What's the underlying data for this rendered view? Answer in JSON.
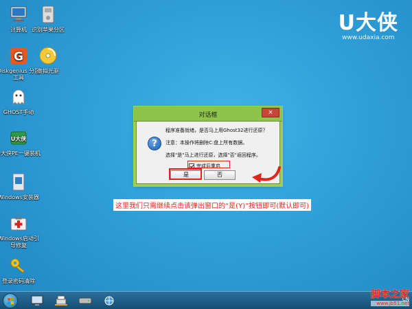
{
  "desktop": {
    "icons": [
      {
        "label": "计算机"
      },
      {
        "label": "识别苹果分区"
      },
      {
        "label": "Diskgenius 分区工具"
      },
      {
        "label": "虚拟光驱"
      },
      {
        "label": "GHOST手动"
      },
      {
        "label": "U大侠PE一键装机"
      },
      {
        "label": "Windows安装器"
      },
      {
        "label": "Windows启动引导修复"
      },
      {
        "label": "登录密码清除"
      }
    ]
  },
  "brand": {
    "logo": "U大侠",
    "url": "www.udaxia.com"
  },
  "dialog": {
    "title": "对话框",
    "close": "×",
    "line1": "程序准备就绪，是否马上用Ghost32进行还原？",
    "line2": "注意：本操作将删除C:盘上所有数据。",
    "line3": "选择\"是\"马上进行还原，选择\"否\"返回程序。",
    "checkbox_label": "完成后重启",
    "checkbox_checked": true,
    "yes_label": "是",
    "no_label": "否"
  },
  "annotation": "这里我们只需继续点击该弹出窗口的“是(Y)”按钮即可(默认即可)",
  "taskbar": {
    "tray_lang": "CN"
  },
  "watermark": {
    "line1": "脚本之家",
    "line2": "www.jb51.net"
  },
  "colors": {
    "accent_red": "#e0261b",
    "dialog_title_bg": "#8ec34c",
    "desktop_bg": "#2f9fd8"
  }
}
